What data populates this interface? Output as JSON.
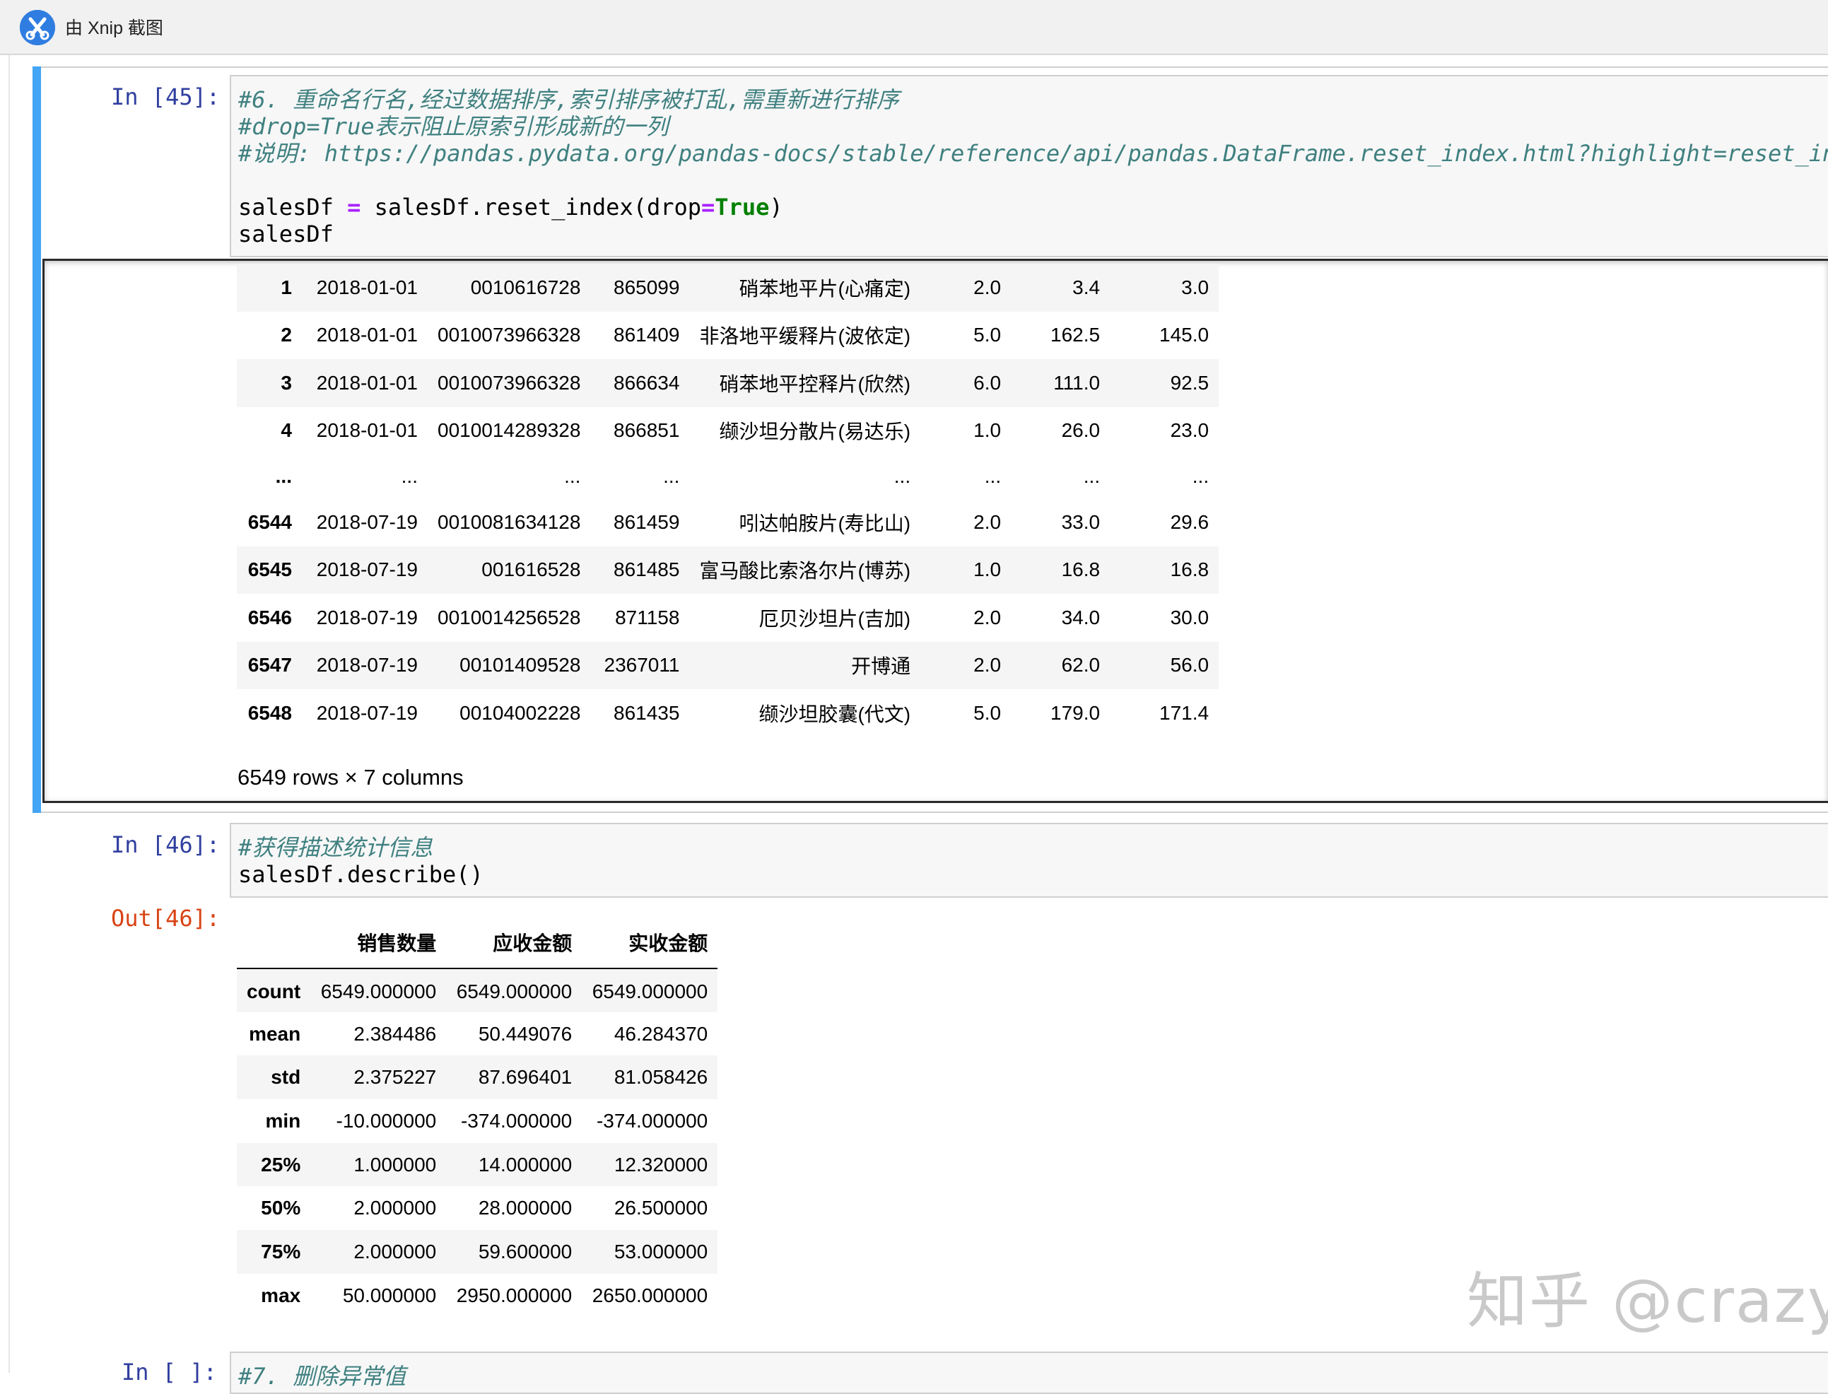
{
  "app": {
    "title": "由 Xnip 截图"
  },
  "cell45": {
    "prompt": "In [45]:",
    "line1": "#6. 重命名行名,经过数据排序,索引排序被打乱,需重新进行排序",
    "line2": "#drop=True表示阻止原索引形成新的一列",
    "line3": "#说明: https://pandas.pydata.org/pandas-docs/stable/reference/api/pandas.DataFrame.reset_index.html?highlight=reset_in",
    "line5_a": "salesDf ",
    "line5_op": "=",
    "line5_b": " salesDf.reset_index(drop",
    "line5_op2": "=",
    "line5_kw": "True",
    "line5_c": ")",
    "line6": "salesDf",
    "rows": [
      {
        "idx": "1",
        "date": "2018-01-01",
        "card": "0010616728",
        "code": "865099",
        "name": "硝苯地平片(心痛定)",
        "qty": "2.0",
        "due": "3.4",
        "paid": "3.0"
      },
      {
        "idx": "2",
        "date": "2018-01-01",
        "card": "0010073966328",
        "code": "861409",
        "name": "非洛地平缓释片(波依定)",
        "qty": "5.0",
        "due": "162.5",
        "paid": "145.0"
      },
      {
        "idx": "3",
        "date": "2018-01-01",
        "card": "0010073966328",
        "code": "866634",
        "name": "硝苯地平控释片(欣然)",
        "qty": "6.0",
        "due": "111.0",
        "paid": "92.5"
      },
      {
        "idx": "4",
        "date": "2018-01-01",
        "card": "0010014289328",
        "code": "866851",
        "name": "缬沙坦分散片(易达乐)",
        "qty": "1.0",
        "due": "26.0",
        "paid": "23.0"
      },
      {
        "idx": "...",
        "date": "...",
        "card": "...",
        "code": "...",
        "name": "...",
        "qty": "...",
        "due": "...",
        "paid": "..."
      },
      {
        "idx": "6544",
        "date": "2018-07-19",
        "card": "0010081634128",
        "code": "861459",
        "name": "吲达帕胺片(寿比山)",
        "qty": "2.0",
        "due": "33.0",
        "paid": "29.6"
      },
      {
        "idx": "6545",
        "date": "2018-07-19",
        "card": "001616528",
        "code": "861485",
        "name": "富马酸比索洛尔片(博苏)",
        "qty": "1.0",
        "due": "16.8",
        "paid": "16.8"
      },
      {
        "idx": "6546",
        "date": "2018-07-19",
        "card": "0010014256528",
        "code": "871158",
        "name": "厄贝沙坦片(吉加)",
        "qty": "2.0",
        "due": "34.0",
        "paid": "30.0"
      },
      {
        "idx": "6547",
        "date": "2018-07-19",
        "card": "00101409528",
        "code": "2367011",
        "name": "开博通",
        "qty": "2.0",
        "due": "62.0",
        "paid": "56.0"
      },
      {
        "idx": "6548",
        "date": "2018-07-19",
        "card": "00104002228",
        "code": "861435",
        "name": "缬沙坦胶囊(代文)",
        "qty": "5.0",
        "due": "179.0",
        "paid": "171.4"
      }
    ],
    "row_count": "6549 rows × 7 columns"
  },
  "cell46": {
    "prompt": "In [46]:",
    "out_prompt": "Out[46]:",
    "line1": "#获得描述统计信息",
    "line2": "salesDf.describe()",
    "columns": [
      "销售数量",
      "应收金额",
      "实收金额"
    ],
    "rows": [
      {
        "stat": "count",
        "qty": "6549.000000",
        "due": "6549.000000",
        "paid": "6549.000000"
      },
      {
        "stat": "mean",
        "qty": "2.384486",
        "due": "50.449076",
        "paid": "46.284370"
      },
      {
        "stat": "std",
        "qty": "2.375227",
        "due": "87.696401",
        "paid": "81.058426"
      },
      {
        "stat": "min",
        "qty": "-10.000000",
        "due": "-374.000000",
        "paid": "-374.000000"
      },
      {
        "stat": "25%",
        "qty": "1.000000",
        "due": "14.000000",
        "paid": "12.320000"
      },
      {
        "stat": "50%",
        "qty": "2.000000",
        "due": "28.000000",
        "paid": "26.500000"
      },
      {
        "stat": "75%",
        "qty": "2.000000",
        "due": "59.600000",
        "paid": "53.000000"
      },
      {
        "stat": "max",
        "qty": "50.000000",
        "due": "2950.000000",
        "paid": "2650.000000"
      }
    ]
  },
  "cell47": {
    "prompt": "In [ ]:",
    "line1": "#7. 删除异常值"
  },
  "watermark": "知乎 @crazy",
  "colors": {
    "selected_bar": "#42a5f5",
    "in_prompt": "#303f9f",
    "out_prompt": "#d84315",
    "comment": "#408080",
    "keyword": "#008000",
    "operator": "#aa22ff"
  },
  "icons": {
    "app": "xnip-scissors-icon"
  }
}
